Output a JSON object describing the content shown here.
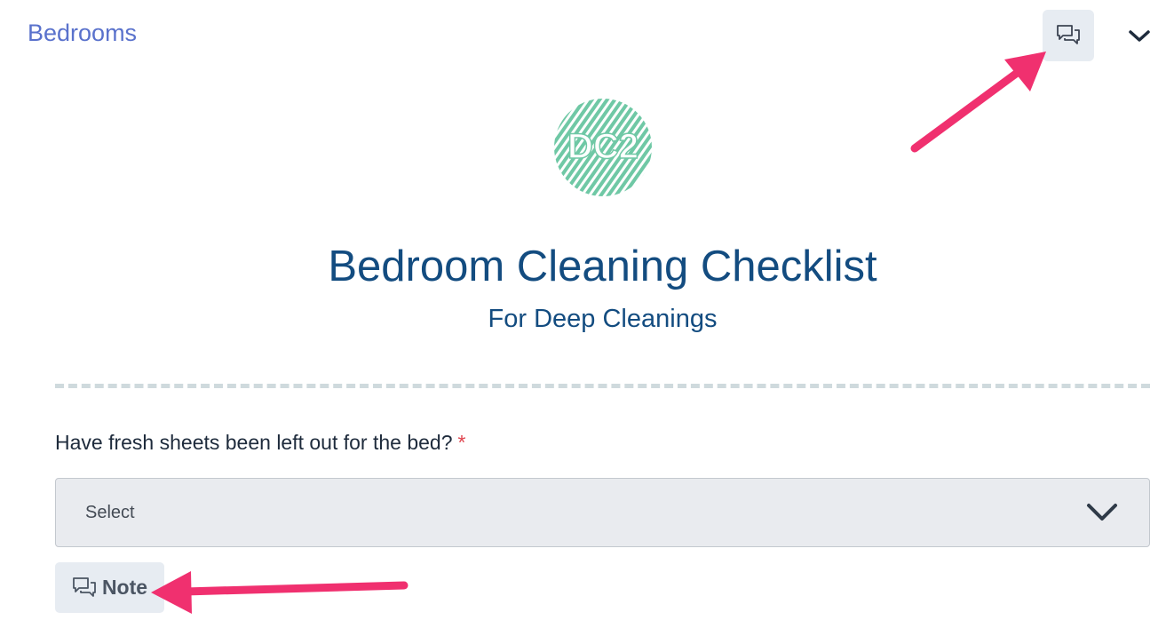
{
  "section": {
    "title": "Bedrooms"
  },
  "header": {
    "comments_icon": "comments-icon",
    "collapse_icon": "chevron-down-icon"
  },
  "logo": {
    "text": "DC2",
    "color": "#6fc8a5"
  },
  "form": {
    "title": "Bedroom Cleaning Checklist",
    "subtitle": "For Deep Cleanings"
  },
  "question": {
    "label": "Have fresh sheets been left out for the bed?",
    "required_marker": "*",
    "select_value": "Select",
    "note_label": "Note"
  },
  "colors": {
    "section_link": "#5a72cc",
    "title": "#134c80",
    "required": "#e0454f",
    "annotation_arrow": "#f0306f"
  }
}
